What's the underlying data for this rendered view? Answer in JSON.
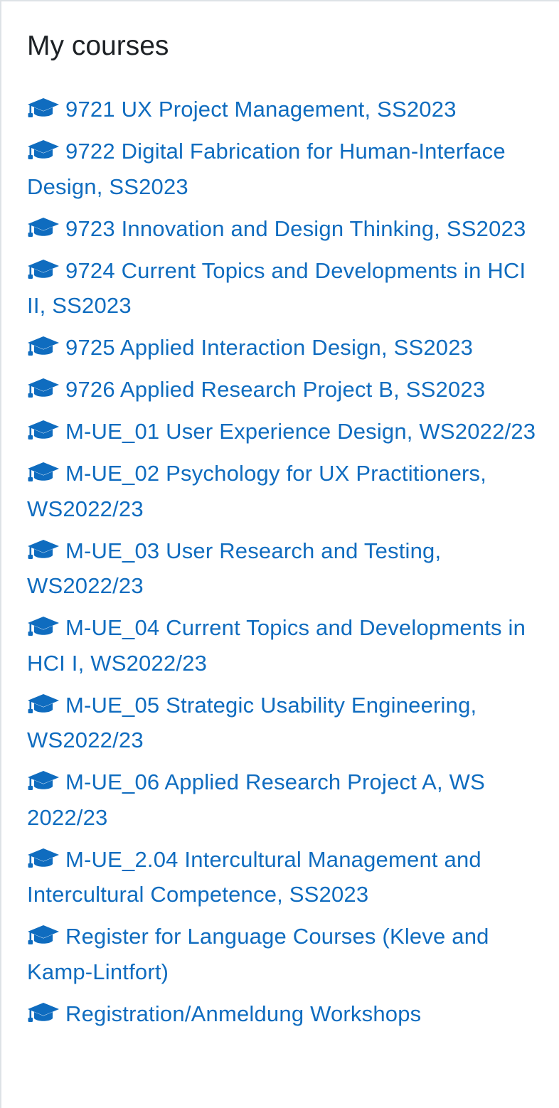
{
  "block": {
    "title": "My courses"
  },
  "colors": {
    "link": "#0f6cbf",
    "title": "#1d2125",
    "border": "#dee2e6"
  },
  "courses": [
    {
      "label": "9721 UX Project Management, SS2023",
      "icon": "graduation-cap-icon"
    },
    {
      "label": "9722 Digital Fabrication for Human-Interface Design, SS2023",
      "icon": "graduation-cap-icon"
    },
    {
      "label": "9723 Innovation and Design Thinking, SS2023",
      "icon": "graduation-cap-icon"
    },
    {
      "label": "9724 Current Topics and Developments in HCI II, SS2023",
      "icon": "graduation-cap-icon"
    },
    {
      "label": "9725 Applied Interaction Design, SS2023",
      "icon": "graduation-cap-icon"
    },
    {
      "label": "9726 Applied Research Project B, SS2023",
      "icon": "graduation-cap-icon"
    },
    {
      "label": "M-UE_01 User Experience Design, WS2022/23",
      "icon": "graduation-cap-icon"
    },
    {
      "label": "M-UE_02 Psychology for UX Practitioners, WS2022/23",
      "icon": "graduation-cap-icon"
    },
    {
      "label": "M-UE_03 User Research and Testing, WS2022/23",
      "icon": "graduation-cap-icon"
    },
    {
      "label": "M-UE_04 Current Topics and Developments in HCI I, WS2022/23",
      "icon": "graduation-cap-icon"
    },
    {
      "label": "M-UE_05 Strategic Usability Engineering, WS2022/23",
      "icon": "graduation-cap-icon"
    },
    {
      "label": "M-UE_06 Applied Research Project A, WS 2022/23",
      "icon": "graduation-cap-icon"
    },
    {
      "label": "M-UE_2.04 Intercultural Management and Intercultural Competence, SS2023",
      "icon": "graduation-cap-icon"
    },
    {
      "label": "Register for Language Courses (Kleve and Kamp-Lintfort)",
      "icon": "graduation-cap-icon"
    },
    {
      "label": "Registration/Anmeldung Workshops",
      "icon": "graduation-cap-icon"
    }
  ]
}
